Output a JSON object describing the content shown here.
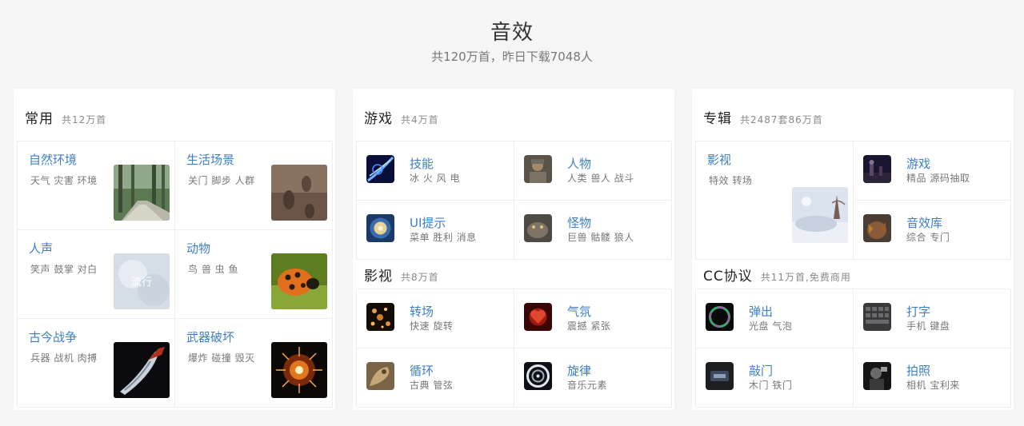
{
  "page": {
    "title": "音效",
    "subtitle": "共120万首，昨日下载7048人"
  },
  "common": {
    "title": "常用",
    "count": "共12万首",
    "items": [
      {
        "name": "自然环境",
        "desc": "天气 灾害 环境",
        "icon": "forest-path-thumbnail"
      },
      {
        "name": "生活场景",
        "desc": "关门 脚步 人群",
        "icon": "footprints-thumbnail"
      },
      {
        "name": "人声",
        "desc": "笑声 鼓掌 对白",
        "icon": "voice-thumbnail"
      },
      {
        "name": "动物",
        "desc": "鸟 兽 虫 鱼",
        "icon": "ladybug-thumbnail"
      },
      {
        "name": "古今战争",
        "desc": "兵器 战机 肉搏",
        "icon": "blade-thumbnail"
      },
      {
        "name": "武器破坏",
        "desc": "爆炸 碰撞 毁灭",
        "icon": "explosion-thumbnail"
      }
    ],
    "voice_thumb_text": "流行"
  },
  "games": {
    "title": "游戏",
    "count": "共4万首",
    "items": [
      {
        "name": "技能",
        "desc": "冰 火 风 电",
        "icon": "skill-thumbnail"
      },
      {
        "name": "人物",
        "desc": "人类 兽人 战斗",
        "icon": "warrior-thumbnail"
      },
      {
        "name": "UI提示",
        "desc": "菜单 胜利 消息",
        "icon": "ui-prompt-thumbnail"
      },
      {
        "name": "怪物",
        "desc": "巨兽 骷髅 狼人",
        "icon": "monster-thumbnail"
      }
    ]
  },
  "film": {
    "title": "影视",
    "count": "共8万首",
    "items": [
      {
        "name": "转场",
        "desc": "快速 旋转",
        "icon": "transition-thumbnail"
      },
      {
        "name": "气氛",
        "desc": "震撼 紧张",
        "icon": "atmosphere-thumbnail"
      },
      {
        "name": "循环",
        "desc": "古典 管弦",
        "icon": "loop-thumbnail"
      },
      {
        "name": "旋律",
        "desc": "音乐元素",
        "icon": "melody-thumbnail"
      }
    ]
  },
  "albums": {
    "title": "专辑",
    "count": "共2487套86万首",
    "feature": {
      "name": "影视",
      "desc": "特效 转场",
      "icon": "snowy-landscape-thumbnail"
    },
    "items": [
      {
        "name": "游戏",
        "desc": "精品 源码抽取",
        "icon": "game-album-thumbnail"
      },
      {
        "name": "音效库",
        "desc": "综合 专门",
        "icon": "sfx-library-thumbnail"
      }
    ]
  },
  "cc": {
    "title": "CC协议",
    "count": "共11万首,免费商用",
    "items": [
      {
        "name": "弹出",
        "desc": "光盘 气泡",
        "icon": "ring-thumbnail"
      },
      {
        "name": "打字",
        "desc": "手机 键盘",
        "icon": "keyboard-thumbnail"
      },
      {
        "name": "敲门",
        "desc": "木门 铁门",
        "icon": "door-thumbnail"
      },
      {
        "name": "拍照",
        "desc": "相机 宝利来",
        "icon": "camera-thumbnail"
      }
    ]
  },
  "colors": {
    "link": "#3d7fc7",
    "background": "#f5f5f5"
  }
}
